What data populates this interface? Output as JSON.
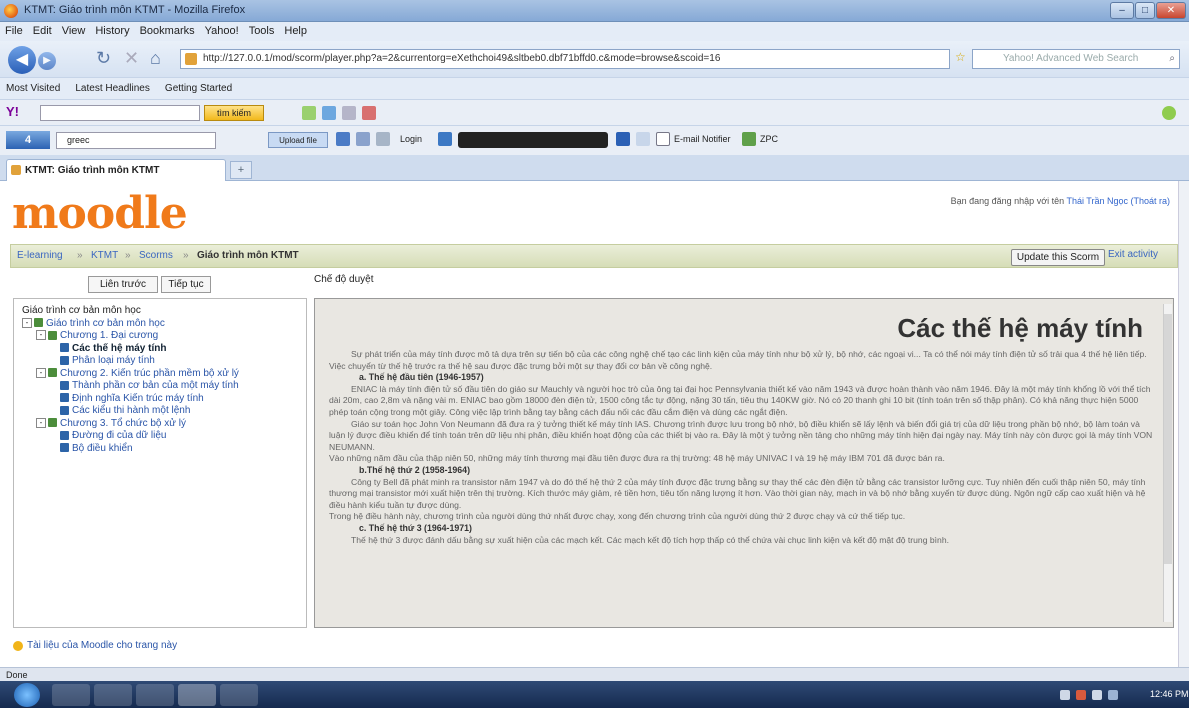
{
  "window": {
    "title": "KTMT: Giáo trình môn KTMT - Mozilla Firefox"
  },
  "menubar": [
    "File",
    "Edit",
    "View",
    "History",
    "Bookmarks",
    "Yahoo!",
    "Tools",
    "Help"
  ],
  "navigation": {
    "url": "http://127.0.0.1/mod/scorm/player.php?a=2&currentorg=eXethchoi49&sltbeb0.dbf71bffd0.c&mode=browse&scoid=16",
    "search_placeholder": "Yahoo! Advanced Web Search"
  },
  "bookmarks": [
    "Most Visited",
    "Latest Headlines",
    "Getting Started"
  ],
  "toolbar_yahoo": {
    "search_button": "tìm kiếm"
  },
  "toolbar_3": {
    "field_value": "greec",
    "upload_label": "Upload file",
    "login_label": "Login",
    "email_label": "E-mail Notifier",
    "zpc_label": "ZPC"
  },
  "tab": {
    "label": "KTMT: Giáo trình môn KTMT",
    "new_tab": "+"
  },
  "header": {
    "logo": "moodle",
    "login_prefix": "Bạn đang đăng nhập với tên",
    "login_user": "Thái Trần Ngọc (Thoát ra)"
  },
  "breadcrumb": {
    "items": [
      "E-learning",
      "KTMT",
      "Scorms",
      "Giáo trình môn KTMT"
    ],
    "separator": "»"
  },
  "actions": {
    "update_label": "Update this Scorm",
    "exit_label": "Exit activity"
  },
  "nav_buttons": {
    "prev_label": "Liên trước",
    "next_label": "Tiếp tục"
  },
  "mode_label": "Chế độ duyệt",
  "toc": [
    {
      "label": "Giáo trình cơ bản môn học",
      "level": 0,
      "kind": "text",
      "exp": ""
    },
    {
      "label": "Giáo trình cơ bản môn học",
      "level": 0,
      "kind": "org",
      "exp": "-"
    },
    {
      "label": "Chương 1. Đại cương",
      "level": 1,
      "kind": "org",
      "exp": "-"
    },
    {
      "label": "Các thế hệ máy tính",
      "level": 2,
      "kind": "sco",
      "exp": "",
      "current": true
    },
    {
      "label": "Phân loại máy tính",
      "level": 2,
      "kind": "sco",
      "exp": ""
    },
    {
      "label": "Chương 2. Kiến trúc phần mềm bộ xử lý",
      "level": 1,
      "kind": "org",
      "exp": "-"
    },
    {
      "label": "Thành phần cơ bản của một máy tính",
      "level": 2,
      "kind": "sco",
      "exp": ""
    },
    {
      "label": "Định nghĩa Kiến trúc máy tính",
      "level": 2,
      "kind": "sco",
      "exp": ""
    },
    {
      "label": "Các kiểu thi hành một lệnh",
      "level": 2,
      "kind": "sco",
      "exp": ""
    },
    {
      "label": "Chương 3. Tổ chức bộ xử lý",
      "level": 1,
      "kind": "org",
      "exp": "-"
    },
    {
      "label": "Đường đi của dữ liệu",
      "level": 2,
      "kind": "sco",
      "exp": ""
    },
    {
      "label": "Bộ điều khiển",
      "level": 2,
      "kind": "sco",
      "exp": ""
    }
  ],
  "content": {
    "title": "Các thế hệ máy tính",
    "blocks": [
      {
        "type": "p",
        "text": "Sự phát triển của máy tính được mô tả dựa trên sự tiến bộ của các công nghệ chế tạo các linh kiện của máy tính như bộ xử lý, bộ nhớ, các ngoại vi... Ta có thể nói máy tính điện tử số trải qua 4 thế hệ liên tiếp. Việc chuyển từ thế hệ trước ra thế hệ sau được đặc trưng bởi một sự thay đổi cơ bản về công nghệ."
      },
      {
        "type": "h",
        "text": "a. Thế hệ đầu tiên (1946-1957)"
      },
      {
        "type": "p",
        "text": "ENIAC là máy tính điện tử số đầu tiên do giáo sư Mauchly và người học trò của ông tại đại học Pennsylvania thiết kế vào năm 1943 và được hoàn thành vào năm 1946. Đây là một máy tính khổng lồ với thể tích dài 20m, cao 2,8m và nặng vài m. ENIAC bao gồm 18000 đèn điện tử, 1500 công tắc tự động, nặng 30 tấn, tiêu thụ 140KW giờ. Nó có 20 thanh ghi 10 bit (tính toán trên số thập phân). Có khả năng thực hiện 5000 phép toán cộng trong một giây. Công việc lập trình bằng tay bằng cách đấu nối các đầu cắm điện và dùng các ngắt điện."
      },
      {
        "type": "p",
        "text": "Giáo sư toán học John Von Neumann đã đưa ra ý tưởng thiết kế máy tính IAS. Chương trình được lưu trong bộ nhớ, bộ điều khiển sẽ lấy lệnh và biến đổi giá trị của dữ liệu trong phần bộ nhớ, bộ làm toán và luận lý được điều khiển để tính toán trên dữ liệu nhị phân, điều khiển hoạt động của các thiết bị vào ra. Đây là một ý tưởng nền tảng cho những máy tính hiện đại ngày nay. Máy tính này còn được gọi là máy tính VON NEUMANN."
      },
      {
        "type": "p0",
        "text": "Vào những năm đầu của thập niên 50, những máy tính thương mại đầu tiên được đưa ra thị trường: 48 hệ máy UNIVAC I và 19 hệ máy IBM 701 đã được bán ra."
      },
      {
        "type": "h",
        "text": "b.Thế hệ thứ 2 (1958-1964)"
      },
      {
        "type": "p",
        "text": "Công ty Bell đã phát minh ra transistor năm 1947 và do đó thế hệ thứ 2 của máy tính được đặc trưng bằng sự thay thế các đèn điện tử bằng các transistor lưỡng cực. Tuy nhiên đến cuối thập niên 50, máy tính thương mại transistor mới xuất hiện trên thị trường. Kích thước máy giảm, rẻ tiền hơn, tiêu tốn năng lượng ít hơn. Vào thời gian này, mạch in và bộ nhớ bằng xuyến từ được dùng. Ngôn ngữ cấp cao xuất hiện và hệ điều hành kiểu tuần tự được dùng."
      },
      {
        "type": "p0",
        "text": "Trong hệ điều hành này, chương trình của người dùng thứ nhất được chạy, xong đến chương trình của người dùng thứ 2 được chạy và cứ thế tiếp tục."
      },
      {
        "type": "h",
        "text": "c. Thế hệ thứ 3 (1964-1971)"
      },
      {
        "type": "p",
        "text": "Thế hệ thứ 3 được đánh dấu bằng sự xuất hiện của các mạch kết. Các mạch kết độ tích hợp thấp có thể chứa vài chục linh kiện và kết độ mật độ trung bình."
      }
    ]
  },
  "footer": {
    "doc_link": "Tài liệu của Moodle cho trang này"
  },
  "statusbar": {
    "text": "Done"
  },
  "taskbar": {
    "clock": "12:46 PM"
  },
  "colors": {
    "moodle_orange": "#f07a1a",
    "breadcrumb_bg": "#d6ddb7",
    "link": "#2a55a8",
    "content_bg": "#e9e7e2"
  }
}
